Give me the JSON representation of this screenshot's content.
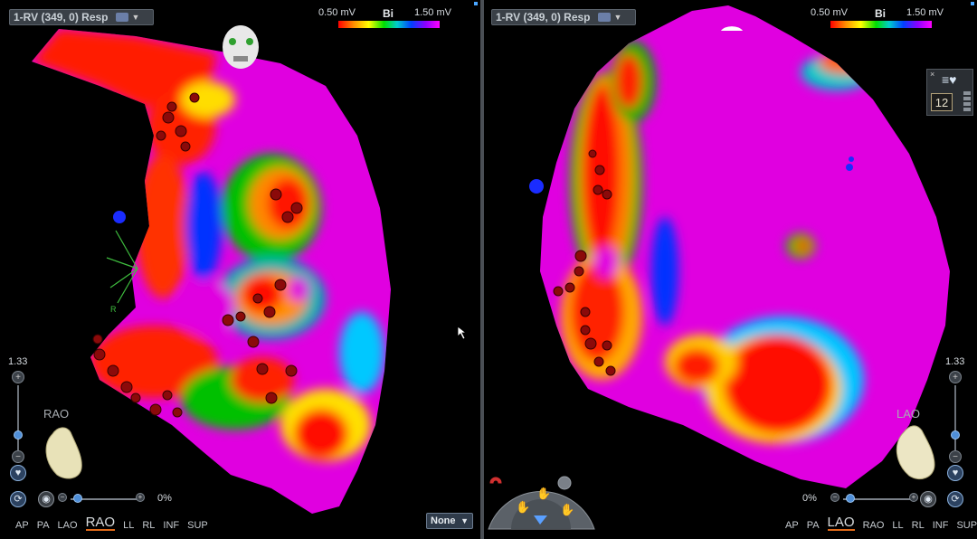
{
  "left_panel": {
    "map_selector": {
      "label": "1-RV (349, 0) Resp"
    },
    "scale": {
      "min_label": "0.50 mV",
      "mode": "Bi",
      "max_label": "1.50 mV"
    },
    "zoom": {
      "value": "1.33"
    },
    "orientation_label": "RAO",
    "opacity": {
      "value": "0%"
    },
    "catheter_label": "R",
    "views": [
      "AP",
      "PA",
      "LAO",
      "RAO",
      "LL",
      "RL",
      "INF",
      "SUP"
    ],
    "active_view": "RAO",
    "projection_select": {
      "value": "None"
    }
  },
  "right_panel": {
    "map_selector": {
      "label": "1-RV (349, 0) Resp"
    },
    "scale": {
      "min_label": "0.50 mV",
      "mode": "Bi",
      "max_label": "1.50 mV"
    },
    "zoom": {
      "value": "1.33"
    },
    "orientation_label": "LAO",
    "opacity": {
      "value": "0%"
    },
    "tool_count": "12",
    "views": [
      "AP",
      "PA",
      "LAO",
      "RAO",
      "LL",
      "RL",
      "INF",
      "SUP"
    ],
    "active_view": "LAO"
  },
  "colors": {
    "scar": "#ff0000",
    "healthy": "#e000e0",
    "background": "#000000",
    "active_view_underline": "#e06a1a"
  },
  "icons": {
    "map_selector": "catheter-map-icon",
    "toggle": "heart-toggle-icon",
    "tool_wheel": "tool-wheel-icon",
    "magnet": "magnet-icon"
  }
}
